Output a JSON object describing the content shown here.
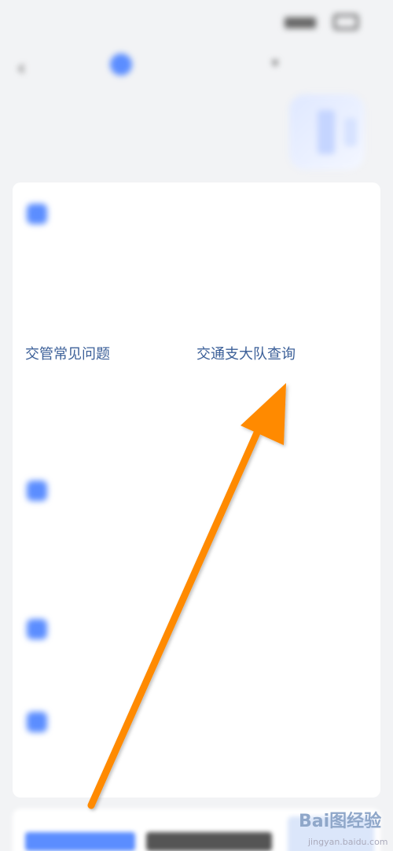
{
  "status_bar": {
    "time": ""
  },
  "header": {
    "title": ""
  },
  "hero": {
    "title": "",
    "subtitle": ""
  },
  "card": {
    "sections": [
      {
        "title": "",
        "links": [
          "",
          "",
          "",
          ""
        ]
      },
      {
        "title": "",
        "links": [
          ""
        ]
      },
      {
        "title": "",
        "links": [
          "",
          "",
          "",
          ""
        ]
      },
      {
        "title": "",
        "links": [
          ""
        ]
      },
      {
        "title": "",
        "links": [
          "",
          ""
        ]
      }
    ],
    "highlighted_row": [
      "交管常见问题",
      "交通支大队查询"
    ]
  },
  "watermark": {
    "brand": "Bai图经验",
    "url": "jingyan.baidu.com"
  },
  "colors": {
    "accent": "#5b8dff",
    "arrow": "#ff8a00",
    "link": "#3b5f98"
  }
}
